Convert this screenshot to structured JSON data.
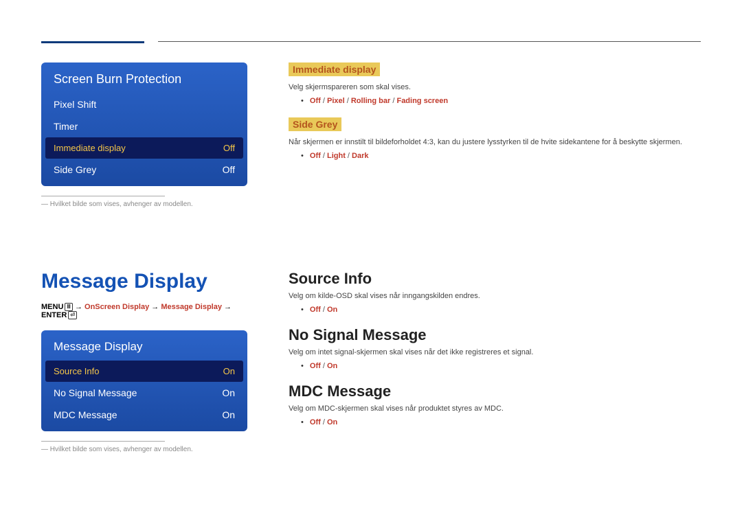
{
  "osd1": {
    "title": "Screen Burn Protection",
    "rows": [
      {
        "label": "Pixel Shift",
        "value": ""
      },
      {
        "label": "Timer",
        "value": ""
      },
      {
        "label": "Immediate display",
        "value": "Off",
        "selected": true
      },
      {
        "label": "Side Grey",
        "value": "Off"
      }
    ],
    "note": "Hvilket bilde som vises, avhenger av modellen."
  },
  "right1": {
    "immediate": {
      "heading": "Immediate display",
      "desc": "Velg skjermspareren som skal vises.",
      "options": [
        "Off",
        "Pixel",
        "Rolling bar",
        "Fading screen"
      ]
    },
    "sidegrey": {
      "heading": "Side Grey",
      "desc": "Når skjermen er innstilt til bildeforholdet 4:3, kan du justere lysstyrken til de hvite sidekantene for å beskytte skjermen.",
      "options": [
        "Off",
        "Light",
        "Dark"
      ]
    }
  },
  "section_title": "Message Display",
  "breadcrumb": {
    "menu": "MENU",
    "path": [
      "OnScreen Display",
      "Message Display"
    ],
    "enter": "ENTER"
  },
  "osd2": {
    "title": "Message Display",
    "rows": [
      {
        "label": "Source Info",
        "value": "On",
        "selected": true
      },
      {
        "label": "No Signal Message",
        "value": "On"
      },
      {
        "label": "MDC Message",
        "value": "On"
      }
    ],
    "note": "Hvilket bilde som vises, avhenger av modellen."
  },
  "right2": {
    "source": {
      "heading": "Source Info",
      "desc": "Velg om kilde-OSD skal vises når inngangskilden endres.",
      "options": [
        "Off",
        "On"
      ]
    },
    "nosignal": {
      "heading": "No Signal Message",
      "desc": "Velg om intet signal-skjermen skal vises når det ikke registreres et signal.",
      "options": [
        "Off",
        "On"
      ]
    },
    "mdc": {
      "heading": "MDC Message",
      "desc": "Velg om MDC-skjermen skal vises når produktet styres av MDC.",
      "options": [
        "Off",
        "On"
      ]
    }
  }
}
